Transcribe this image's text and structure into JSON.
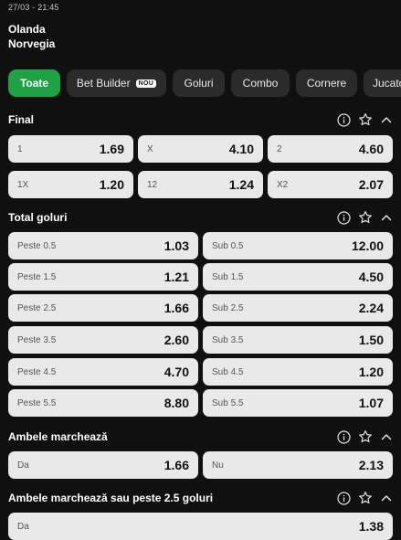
{
  "match": {
    "date": "27/03 - 21:45",
    "home": "Olanda",
    "away": "Norvegia"
  },
  "tabs": [
    {
      "label": "Toate",
      "active": true
    },
    {
      "label": "Bet Builder",
      "badge": "NOU"
    },
    {
      "label": "Goluri"
    },
    {
      "label": "Combo"
    },
    {
      "label": "Cornere"
    },
    {
      "label": "Jucato"
    }
  ],
  "sections": {
    "final": {
      "title": "Final",
      "odds": [
        {
          "label": "1",
          "value": "1.69"
        },
        {
          "label": "X",
          "value": "4.10"
        },
        {
          "label": "2",
          "value": "4.60"
        },
        {
          "label": "1X",
          "value": "1.20"
        },
        {
          "label": "12",
          "value": "1.24"
        },
        {
          "label": "X2",
          "value": "2.07"
        }
      ]
    },
    "total_goals": {
      "title": "Total goluri",
      "odds": [
        {
          "label": "Peste 0.5",
          "value": "1.03"
        },
        {
          "label": "Sub 0.5",
          "value": "12.00"
        },
        {
          "label": "Peste 1.5",
          "value": "1.21"
        },
        {
          "label": "Sub 1.5",
          "value": "4.50"
        },
        {
          "label": "Peste 2.5",
          "value": "1.66"
        },
        {
          "label": "Sub 2.5",
          "value": "2.24"
        },
        {
          "label": "Peste 3.5",
          "value": "2.60"
        },
        {
          "label": "Sub 3.5",
          "value": "1.50"
        },
        {
          "label": "Peste 4.5",
          "value": "4.70"
        },
        {
          "label": "Sub 4.5",
          "value": "1.20"
        },
        {
          "label": "Peste 5.5",
          "value": "8.80"
        },
        {
          "label": "Sub 5.5",
          "value": "1.07"
        }
      ]
    },
    "btts": {
      "title": "Ambele marchează",
      "odds": [
        {
          "label": "Da",
          "value": "1.66"
        },
        {
          "label": "Nu",
          "value": "2.13"
        }
      ]
    },
    "btts_over": {
      "title": "Ambele marchează sau peste 2.5 goluri",
      "odds": [
        {
          "label": "Da",
          "value": "1.38"
        }
      ]
    }
  },
  "icons": {
    "info": "info-icon",
    "favorite": "star-icon",
    "collapse": "chevron-up-icon"
  },
  "colors": {
    "accent": "#1fa246",
    "background": "#101010",
    "odd_bg": "#e9e9e9",
    "tab_bg": "#2b2b2b"
  }
}
